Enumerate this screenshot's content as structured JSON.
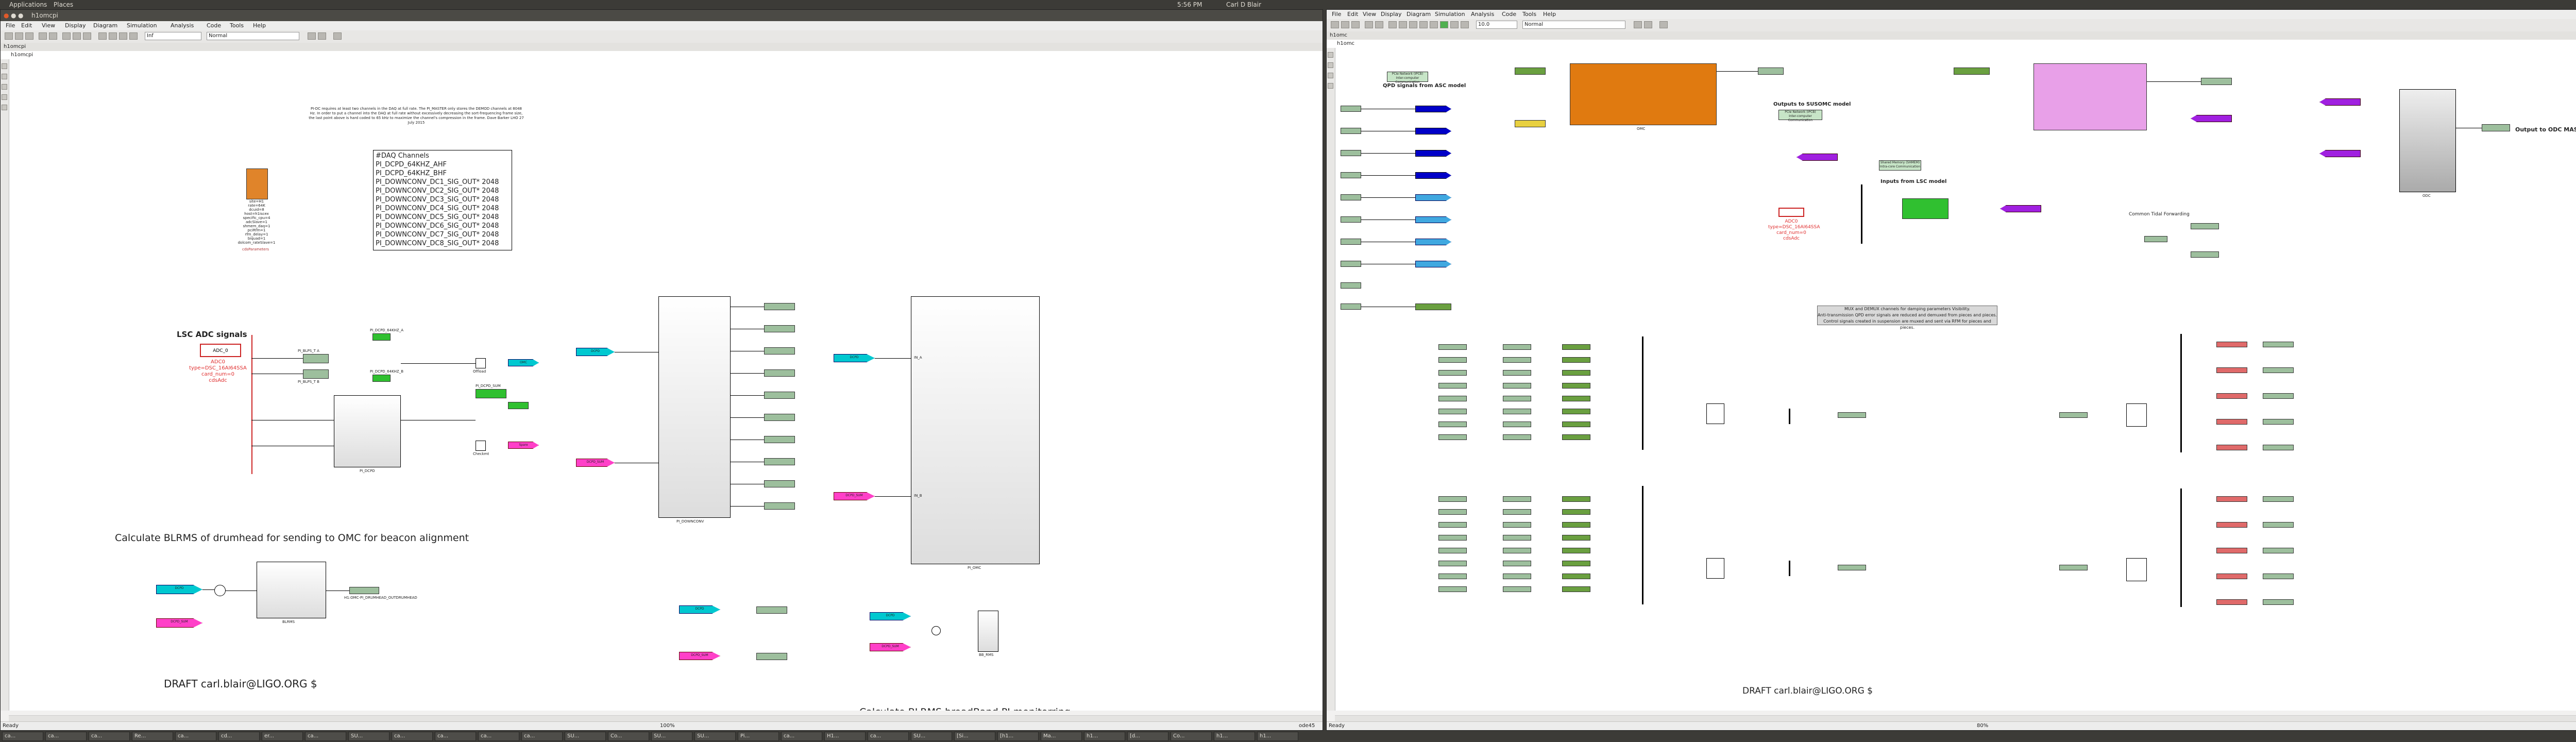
{
  "top_panel": {
    "apps": "Applications",
    "places": "Places",
    "clock": "5:56 PM",
    "user": "Carl D Blair"
  },
  "left_window": {
    "title": "h1omcpi",
    "menu": [
      "File",
      "Edit",
      "View",
      "Display",
      "Diagram",
      "Simulation",
      "Analysis",
      "Code",
      "Tools",
      "Help"
    ],
    "sim_time": "Inf",
    "sim_mode": "Normal",
    "tab": "h1omcpi",
    "address": "h1omcpi",
    "status_left": "Ready",
    "status_zoom": "100%",
    "status_right": "ode45",
    "diagram": {
      "desc_text": "PI-DC requires at least two channels in the DAQ at full rate. The PI_MASTER only stores the DEMOD channels at 8048 Hz. In order to put a channel into the DAQ at full rate without excessively decreasing the sort-frequencing frame size, the last point above is hard coded to 65 kHz to maximize the channel's compression in the frame. Dave Barker LHO 27 July 2015",
      "daq_title": "#DAQ Channels",
      "daq_lines": [
        "PI_DCPD_64KHZ_AHF",
        "PI_DCPD_64KHZ_BHF",
        "PI_DOWNCONV_DC1_SIG_OUT* 2048",
        "PI_DOWNCONV_DC2_SIG_OUT* 2048",
        "PI_DOWNCONV_DC3_SIG_OUT* 2048",
        "PI_DOWNCONV_DC4_SIG_OUT* 2048",
        "PI_DOWNCONV_DC5_SIG_OUT* 2048",
        "PI_DOWNCONV_DC6_SIG_OUT* 2048",
        "PI_DOWNCONV_DC7_SIG_OUT* 2048",
        "PI_DOWNCONV_DC8_SIG_OUT* 2048"
      ],
      "params_block": "site=H1\nrate=64K\ndcuid=8\nhost=h1iscex\nspecific_cpu=4\nadcSlave=1\nshmem_daq=1\npciRfm=1\nrfm_delay=1\nbiquad=1\ndolcom_rateSlave=1",
      "params_label": "cdsParameters",
      "lsc_adc": "LSC ADC signals",
      "adc_block": "ADC_0",
      "adc_label_lines": [
        "ADC0",
        "type=DSC_16AI64SSA",
        "card_num=0",
        "cdsAdc"
      ],
      "filt_a": "PI_BLPS_T A",
      "filt_b": "PI_BLPS_T B",
      "dcpd_block": "PI_DCPD",
      "dcpd64a": "PI_DCPD_64KHZ_A",
      "dcpd64b": "PI_DCPD_64KHZ_B",
      "offload": "Offload",
      "dcpd_sum": "PI_DCPD_SUM",
      "checkmt": "Checkmt",
      "tag_omc": "OMC",
      "tag_spare": "Spare",
      "tag_dcpd": "DCPD",
      "tag_dcpd_sum": "DCPD_SUM",
      "downconv": "PI_DOWNCONV",
      "pi_omc": "PI_OMC",
      "in_a": "IN_A",
      "in_b": "IN_B",
      "heading_drum": "Calculate BLRMS of drumhead for sending to OMC for beacon alignment",
      "blrms": "BLRMS",
      "drumhead_out": "H1:OMC-PI_DRUMHEAD_OUTDRUMHEAD",
      "draft_left": "DRAFT carl.blair@LIGO.ORG $",
      "heading_bb": "Calculate BLRMS broadBand PI monitorring",
      "blrms_bb": "BB_RMS"
    }
  },
  "right_window": {
    "title": "h1omc",
    "menu": [
      "File",
      "Edit",
      "View",
      "Display",
      "Diagram",
      "Simulation",
      "Analysis",
      "Code",
      "Tools",
      "Help"
    ],
    "sim_time": "10.0",
    "sim_mode": "Normal",
    "tab": "h1omc",
    "address": "h1omc",
    "status_left": "Ready",
    "status_zoom": "80%",
    "diagram": {
      "note_pcie_1": "PCIe Network (IPCB)\nInter-computer Communication",
      "qpd_from_asc": "QPD signals from ASC model",
      "note_pcie_2": "PCIe Network (IPCB)\nInter-computer Communication",
      "outputs_susomc": "Outputs to SUSOMC model",
      "note_shmem": "Shared Memory (SHMEM)\nIntra-core Communication",
      "inputs_lsc": "Inputs from LSC model",
      "omc_block": "OMC",
      "odc_block": "ODC",
      "output_odc": "Output to ODC MASTER model",
      "common_tidal": "Common Tidal Forwarding",
      "adc_lines": [
        "ADC0",
        "type=DSC_16AI64SSA",
        "card_num=0",
        "cdsAdc"
      ],
      "mux_note": "MUX and DEMUX channels for damping parameters Visibility.\nAnti-transmission QPD error signals are reduced and demuxed from pieces and pieces.\nControl signals created in suspension are muxed and sent via RFM for pieces and pieces.",
      "draft_right": "DRAFT carl.blair@LIGO.ORG $"
    }
  },
  "taskbar": [
    "ca...",
    "ca...",
    "ca...",
    "Re...",
    "ca...",
    "cd...",
    "er...",
    "ca...",
    "SU...",
    "ca...",
    "ca...",
    "ca...",
    "ca...",
    "SU...",
    "Co...",
    "SU...",
    "SU...",
    "Pi...",
    "ca...",
    "H1...",
    "ca...",
    "SU...",
    "[Si...",
    "[h1...",
    "Ma...",
    "h1...",
    "[d...",
    "Co...",
    "h1...",
    "h1..."
  ]
}
